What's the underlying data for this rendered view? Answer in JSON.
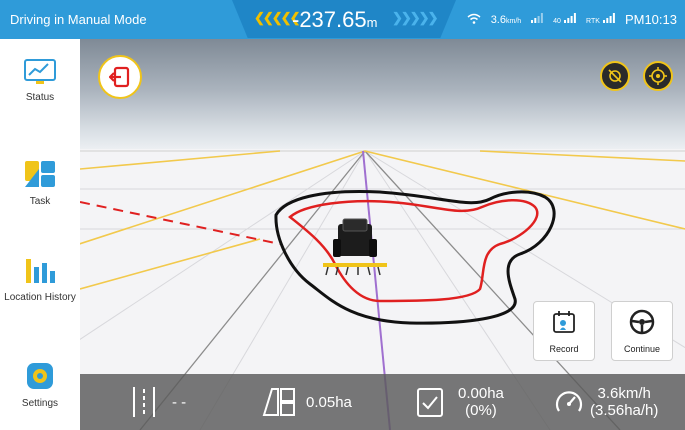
{
  "header": {
    "mode_title": "Driving in Manual Mode",
    "distance_value": "-237.65",
    "distance_unit": "m",
    "speed_indicator": "3.6",
    "speed_unit": "km/h",
    "signal_badge_1": "40",
    "signal_badge_2": "RTK",
    "clock": "PM10:13"
  },
  "sidebar": {
    "items": [
      {
        "label": "Status",
        "icon": "status-chart-icon"
      },
      {
        "label": "Task",
        "icon": "task-icon"
      },
      {
        "label": "Location History",
        "icon": "location-history-icon"
      },
      {
        "label": "Settings",
        "icon": "gear-icon"
      }
    ]
  },
  "map": {
    "exit_icon": "exit-icon",
    "top_right_icons": [
      "no-signal-icon",
      "crosshair-icon"
    ]
  },
  "actions": {
    "record_label": "Record",
    "continue_label": "Continue"
  },
  "bottom": {
    "line_value": "- -",
    "area_value": "0.05ha",
    "done_area": "0.00ha",
    "done_percent": "(0%)",
    "speed": "3.6km/h",
    "rate": "(3.56ha/h)"
  },
  "colors": {
    "header_blue": "#2f9bd9",
    "accent_yellow": "#f0c419",
    "track_red": "#e02020",
    "boundary_black": "#111111",
    "guide_yellow": "#f2c94c",
    "center_line_purple": "#a070d0"
  }
}
